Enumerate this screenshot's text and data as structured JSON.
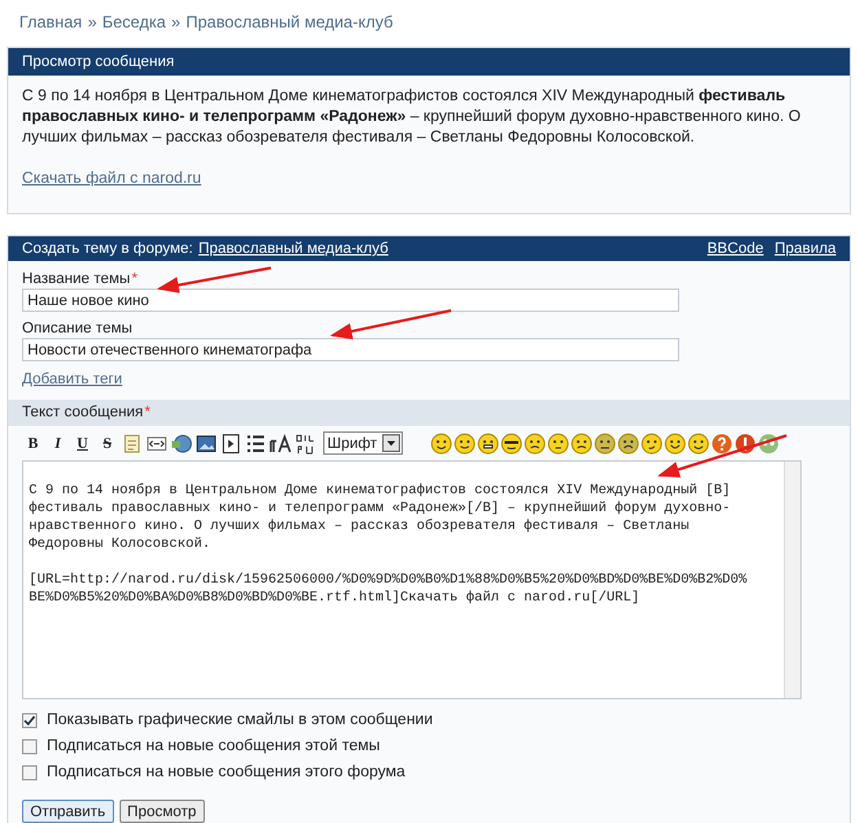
{
  "breadcrumb": [
    "Главная",
    "Беседка",
    "Православный медиа-клуб"
  ],
  "breadcrumb_separator": "»",
  "preview": {
    "title": "Просмотр сообщения",
    "text": "С 9 по 14 ноября в Центральном Доме кинематографистов состоялся XIV Международный **фестиваль православных кино- и телепрограмм «Радонеж»** – крупнейший форум духовно-нравственного кино. О лучших фильмах – рассказ обозревателя фестиваля – Светланы Федоровны Колосовской.",
    "link": "Скачать файл с narod.ru"
  },
  "form": {
    "title": "Создать тему в форуме:",
    "forum_link": "Православный медиа-клуб",
    "header_links": [
      "BBCode",
      "Правила"
    ],
    "fields": [
      {
        "label": "Название темы",
        "required_mark": "*",
        "value": "Наше новое кино"
      },
      {
        "label": "Описание темы",
        "value": "Новости отечественного кинематографа"
      }
    ],
    "tags_link": "Добавить теги",
    "message_label": "Текст сообщения",
    "message_required_mark": "*",
    "toolbar": [
      {
        "kind": "bold",
        "label": "B"
      },
      {
        "kind": "italic",
        "label": "I"
      },
      {
        "kind": "underline",
        "label": "U"
      },
      {
        "kind": "strike",
        "label": "S"
      },
      {
        "kind": "quote"
      },
      {
        "kind": "code"
      },
      {
        "kind": "link"
      },
      {
        "kind": "image"
      },
      {
        "kind": "media"
      },
      {
        "kind": "list"
      },
      {
        "kind": "size"
      },
      {
        "kind": "translit"
      }
    ],
    "font_select": "Шрифт",
    "message": "\nС 9 по 14 ноября в Центральном Доме кинематографистов состоялся XIV Международный [B]\nфестиваль православных кино- и телепрограмм «Радонеж»[/B] – крупнейший форум духовно-\nнравственного кино. О лучших фильмах – рассказ обозревателя фестиваля – Светланы\nФедоровны Колосовской.\n\n[URL=http://narod.ru/disk/15962506000/%D0%9D%D0%B0%D1%88%D0%B5%20%D0%BD%D0%BE%D0%B2%D0%\nBE%D0%B5%20%D0%BA%D0%B8%D0%BD%D0%BE.rtf.html]Скачать файл с narod.ru[/URL]",
    "options": [
      {
        "label": "Показывать графические смайлы в этом сообщении",
        "checked": true
      },
      {
        "label": "Подписаться на новые сообщения этой темы",
        "checked": false
      },
      {
        "label": "Подписаться на новые сообщения этого форума",
        "checked": false
      }
    ],
    "buttons": [
      {
        "label": "Отправить",
        "selected": true
      },
      {
        "label": "Просмотр",
        "selected": false
      }
    ]
  }
}
